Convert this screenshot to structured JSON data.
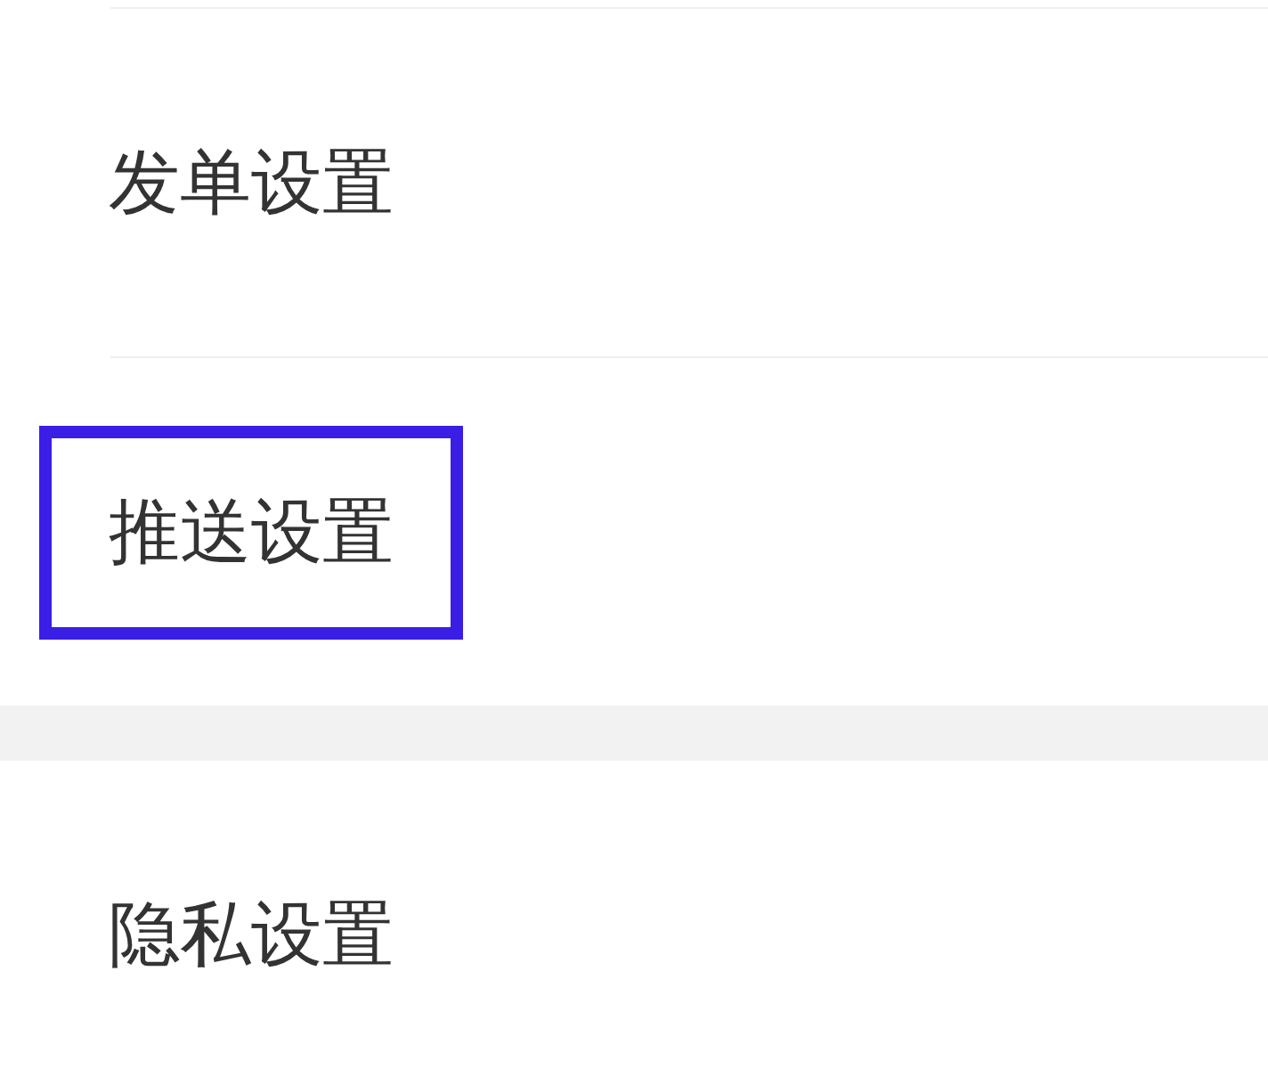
{
  "sections": [
    {
      "items": [
        {
          "label": "发单设置",
          "highlighted": false
        },
        {
          "label": "推送设置",
          "highlighted": true
        }
      ]
    },
    {
      "items": [
        {
          "label": "隐私设置",
          "highlighted": false
        }
      ]
    }
  ]
}
